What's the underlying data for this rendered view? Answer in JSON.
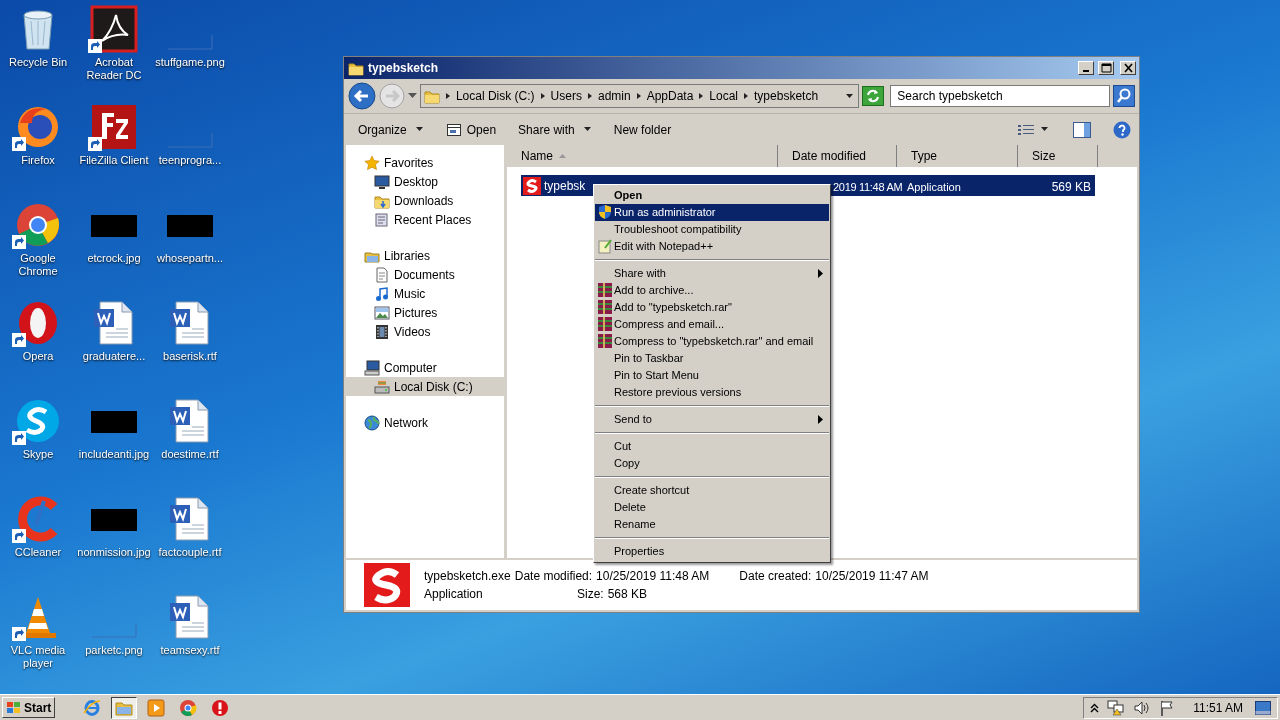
{
  "desktop": {
    "icons": [
      {
        "label": "Recycle Bin",
        "kind": "bin",
        "shortcut": false
      },
      {
        "label": "Firefox",
        "kind": "firefox",
        "shortcut": true
      },
      {
        "label": "Google Chrome",
        "kind": "chrome",
        "shortcut": true
      },
      {
        "label": "Opera",
        "kind": "opera",
        "shortcut": true
      },
      {
        "label": "Skype",
        "kind": "skype",
        "shortcut": true
      },
      {
        "label": "CCleaner",
        "kind": "ccleaner",
        "shortcut": true
      },
      {
        "label": "VLC media player",
        "kind": "vlc",
        "shortcut": true
      },
      {
        "label": "Acrobat Reader DC",
        "kind": "acrobat",
        "shortcut": true
      },
      {
        "label": "FileZilla Client",
        "kind": "filezilla",
        "shortcut": true
      },
      {
        "label": "etcrock.jpg",
        "kind": "dark",
        "shortcut": false
      },
      {
        "label": "graduatere...",
        "kind": "doc",
        "shortcut": false
      },
      {
        "label": "includeanti.jpg",
        "kind": "dark",
        "shortcut": false
      },
      {
        "label": "nonmission.jpg",
        "kind": "dark",
        "shortcut": false
      },
      {
        "label": "parketc.png",
        "kind": "blank",
        "shortcut": false
      },
      {
        "label": "stuffgame.png",
        "kind": "blank",
        "shortcut": false
      },
      {
        "label": "teenprogra...",
        "kind": "blank",
        "shortcut": false
      },
      {
        "label": "whosepartn...",
        "kind": "dark",
        "shortcut": false
      },
      {
        "label": "baserisk.rtf",
        "kind": "doc",
        "shortcut": false
      },
      {
        "label": "doestime.rtf",
        "kind": "doc",
        "shortcut": false
      },
      {
        "label": "factcouple.rtf",
        "kind": "doc",
        "shortcut": false
      },
      {
        "label": "teamsexy.rtf",
        "kind": "doc",
        "shortcut": false
      }
    ]
  },
  "explorer": {
    "title": "typebsketch",
    "address": [
      "Local Disk (C:)",
      "Users",
      "admin",
      "AppData",
      "Local",
      "typebsketch"
    ],
    "search": {
      "placeholder": "Search typebsketch"
    },
    "toolbar": [
      {
        "label": "Organize",
        "kind": "menu"
      },
      {
        "label": "Open",
        "kind": "open"
      },
      {
        "label": "Share with",
        "kind": "menu"
      },
      {
        "label": "New folder",
        "kind": "plain"
      }
    ],
    "nav": [
      {
        "label": "Favorites",
        "selected": false,
        "children": [
          {
            "label": "Desktop",
            "selected": false
          },
          {
            "label": "Downloads",
            "selected": false
          },
          {
            "label": "Recent Places",
            "selected": false
          }
        ]
      },
      {
        "label": "Libraries",
        "selected": false,
        "children": [
          {
            "label": "Documents",
            "selected": false
          },
          {
            "label": "Music",
            "selected": false
          },
          {
            "label": "Pictures",
            "selected": false
          },
          {
            "label": "Videos",
            "selected": false
          }
        ]
      },
      {
        "label": "Computer",
        "selected": false,
        "children": [
          {
            "label": "Local Disk (C:)",
            "selected": true
          }
        ]
      },
      {
        "label": "Network",
        "selected": false
      }
    ],
    "columns": [
      {
        "label": "Name",
        "sorted": true
      },
      {
        "label": "Date modified",
        "sorted": false
      },
      {
        "label": "Type",
        "sorted": false
      },
      {
        "label": "Size",
        "sorted": false
      }
    ],
    "rows": [
      {
        "name": "typebsk",
        "date": "2019 11:48 AM",
        "type": "Application",
        "size": "569 KB",
        "selected": true
      }
    ],
    "context_menu": [
      {
        "kind": "item",
        "label": "Open",
        "default": true,
        "selected": false,
        "submenu": false
      },
      {
        "kind": "item",
        "label": "Run as administrator",
        "default": false,
        "selected": true,
        "submenu": false
      },
      {
        "kind": "item",
        "label": "Troubleshoot compatibility",
        "default": false,
        "selected": false,
        "submenu": false
      },
      {
        "kind": "item",
        "label": "Edit with Notepad++",
        "default": false,
        "selected": false,
        "submenu": false
      },
      {
        "kind": "separator"
      },
      {
        "kind": "item",
        "label": "Share with",
        "default": false,
        "selected": false,
        "submenu": true
      },
      {
        "kind": "item",
        "label": "Add to archive...",
        "default": false,
        "selected": false,
        "submenu": false
      },
      {
        "kind": "item",
        "label": "Add to \"typebsketch.rar\"",
        "default": false,
        "selected": false,
        "submenu": false
      },
      {
        "kind": "item",
        "label": "Compress and email...",
        "default": false,
        "selected": false,
        "submenu": false
      },
      {
        "kind": "item",
        "label": "Compress to \"typebsketch.rar\" and email",
        "default": false,
        "selected": false,
        "submenu": false
      },
      {
        "kind": "item",
        "label": "Pin to Taskbar",
        "default": false,
        "selected": false,
        "submenu": false
      },
      {
        "kind": "item",
        "label": "Pin to Start Menu",
        "default": false,
        "selected": false,
        "submenu": false
      },
      {
        "kind": "item",
        "label": "Restore previous versions",
        "default": false,
        "selected": false,
        "submenu": false
      },
      {
        "kind": "separator"
      },
      {
        "kind": "item",
        "label": "Send to",
        "default": false,
        "selected": false,
        "submenu": true
      },
      {
        "kind": "separator"
      },
      {
        "kind": "item",
        "label": "Cut",
        "default": false,
        "selected": false,
        "submenu": false
      },
      {
        "kind": "item",
        "label": "Copy",
        "default": false,
        "selected": false,
        "submenu": false
      },
      {
        "kind": "separator"
      },
      {
        "kind": "item",
        "label": "Create shortcut",
        "default": false,
        "selected": false,
        "submenu": false
      },
      {
        "kind": "item",
        "label": "Delete",
        "default": false,
        "selected": false,
        "submenu": false
      },
      {
        "kind": "item",
        "label": "Rename",
        "default": false,
        "selected": false,
        "submenu": false
      },
      {
        "kind": "separator"
      },
      {
        "kind": "item",
        "label": "Properties",
        "default": false,
        "selected": false,
        "submenu": false
      }
    ],
    "details": {
      "name": "typebsketch.exe",
      "type": "Application",
      "fields": [
        {
          "label": "Date modified:",
          "value": "10/25/2019 11:48 AM"
        },
        {
          "label": "Size:",
          "value": "568 KB"
        },
        {
          "label": "Date created:",
          "value": "10/25/2019 11:47 AM"
        }
      ]
    }
  },
  "taskbar": {
    "start": "Start",
    "apps": [
      {
        "kind": "ie",
        "active": false
      },
      {
        "kind": "explorer",
        "active": true
      },
      {
        "kind": "media",
        "active": false
      },
      {
        "kind": "chrome",
        "active": false
      },
      {
        "kind": "stop",
        "active": false
      }
    ],
    "clock": "11:51 AM"
  }
}
